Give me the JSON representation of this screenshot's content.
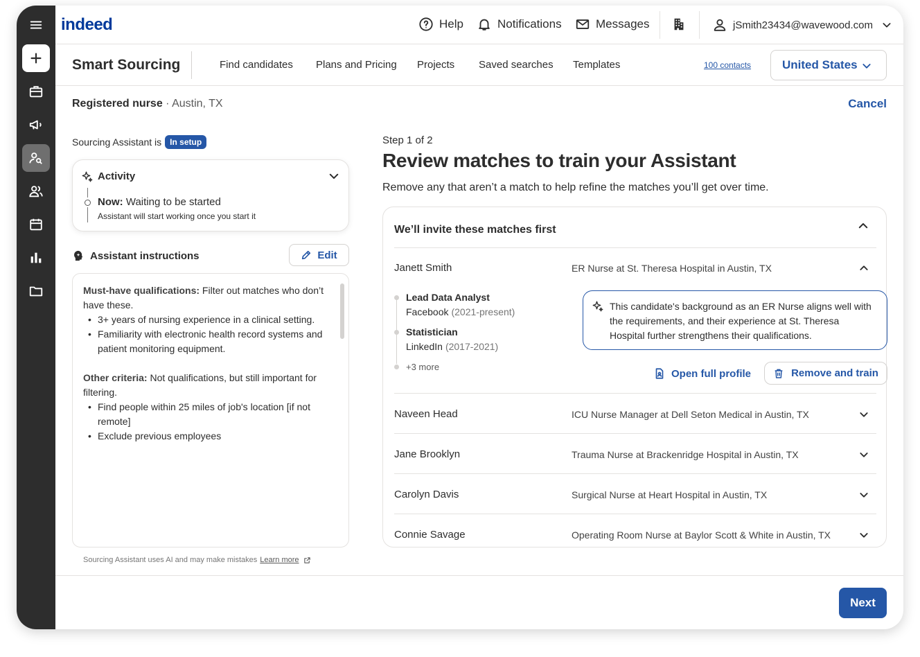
{
  "topbar": {
    "logo": "indeed",
    "help": "Help",
    "notifications": "Notifications",
    "messages": "Messages",
    "account": "jSmith23434@wavewood.com"
  },
  "subnav": {
    "product": "Smart Sourcing",
    "links": [
      "Find candidates",
      "Plans and Pricing",
      "Projects",
      "Saved searches",
      "Templates"
    ],
    "contacts": "100 contacts",
    "country": "United States"
  },
  "job": {
    "title": "Registered nurse",
    "location": "Austin, TX",
    "cancel": "Cancel"
  },
  "assistant": {
    "status_prefix": "Sourcing Assistant is",
    "status_badge": "In setup",
    "activity_title": "Activity",
    "now_label": "Now:",
    "now_text": "Waiting to be started",
    "now_sub": "Assistant will start working once you start it",
    "instructions_title": "Assistant instructions",
    "edit": "Edit",
    "must_label": "Must-have qualifications:",
    "must_text": "Filter out matches who don’t have these.",
    "must_items": [
      "3+ years of nursing experience in a clinical setting.",
      "Familiarity with electronic health record systems and patient monitoring equipment."
    ],
    "other_label": "Other criteria:",
    "other_text": "Not qualifications, but still important for filtering.",
    "other_items": [
      "Find people within 25 miles of job's location [if not remote]",
      "Exclude previous employees"
    ],
    "disclaimer": "Sourcing Assistant uses AI and may make mistakes",
    "learn_more": "Learn more"
  },
  "review": {
    "step": "Step 1 of 2",
    "heading": "Review matches to train your Assistant",
    "lead": "Remove any that aren’t a match to help refine the matches you’ll get over time.",
    "section_title": "We’ll invite these matches first",
    "expanded": {
      "name": "Janett Smith",
      "job": "ER Nurse at St. Theresa Hospital in Austin, TX",
      "history": [
        {
          "role": "Lead Data Analyst",
          "company": "Facebook",
          "years": "(2021-present)"
        },
        {
          "role": "Statistician",
          "company": "LinkedIn",
          "years": "(2017-2021)"
        }
      ],
      "more": "+3 more",
      "ai_summary": "This candidate's background as an ER Nurse aligns well with the requirements, and their experience at St. Theresa Hospital further strengthens their qualifications.",
      "open_profile": "Open full profile",
      "remove_train": "Remove and train"
    },
    "candidates": [
      {
        "name": "Naveen Head",
        "job": "ICU Nurse Manager at Dell Seton Medical in Austin, TX"
      },
      {
        "name": "Jane Brooklyn",
        "job": "Trauma Nurse at Brackenridge Hospital in Austin, TX"
      },
      {
        "name": "Carolyn Davis",
        "job": "Surgical Nurse at Heart Hospital in Austin, TX"
      },
      {
        "name": "Connie Savage",
        "job": "Operating Room Nurse at Baylor Scott & White in Austin, TX"
      }
    ],
    "next": "Next"
  },
  "colors": {
    "brand_blue": "#2557a7",
    "rail": "#2d2d2d",
    "logo_blue": "#003a9b"
  },
  "icons": {
    "rail": [
      "menu-icon",
      "plus-icon",
      "briefcase-icon",
      "megaphone-icon",
      "person-search-icon",
      "people-icon",
      "calendar-icon",
      "bar-chart-icon",
      "folder-icon"
    ]
  }
}
